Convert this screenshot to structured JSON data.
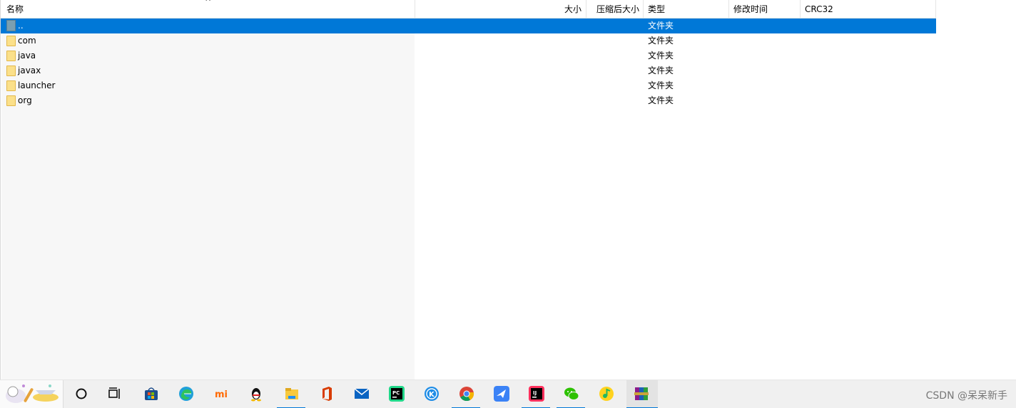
{
  "columns": {
    "name": "名称",
    "size": "大小",
    "packed": "压缩后大小",
    "type": "类型",
    "modified": "修改时间",
    "crc": "CRC32"
  },
  "sort_indicator": "^",
  "rows": [
    {
      "name": "..",
      "type": "文件夹"
    },
    {
      "name": "com",
      "type": "文件夹"
    },
    {
      "name": "java",
      "type": "文件夹"
    },
    {
      "name": "javax",
      "type": "文件夹"
    },
    {
      "name": "launcher",
      "type": "文件夹"
    },
    {
      "name": "org",
      "type": "文件夹"
    }
  ],
  "taskbar": {
    "apps": [
      "cortana-icon",
      "task-view-icon",
      "store-icon",
      "edge-icon",
      "mi-icon",
      "qq-icon",
      "file-explorer-icon",
      "office-icon",
      "mail-icon",
      "pycharm-icon",
      "kugou-icon",
      "chrome-icon",
      "feishu-icon",
      "intellij-icon",
      "wechat-icon",
      "qqmusic-icon",
      "winrar-icon"
    ],
    "watermark": "CSDN @呆呆新手"
  },
  "colors": {
    "selection": "#0078d7",
    "folder": "#fbe08a"
  }
}
